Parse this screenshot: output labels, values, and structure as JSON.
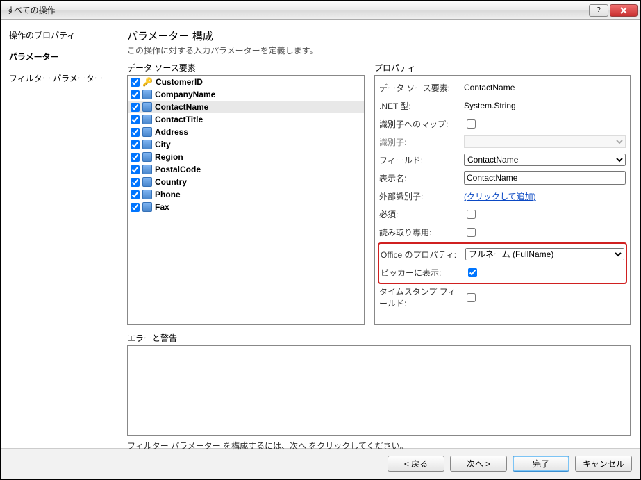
{
  "window": {
    "title": "すべての操作"
  },
  "nav": {
    "items": [
      {
        "label": "操作のプロパティ"
      },
      {
        "label": "パラメーター"
      },
      {
        "label": "フィルター パラメーター"
      }
    ],
    "activeIndex": 1
  },
  "main": {
    "heading": "パラメーター 構成",
    "subheading": "この操作に対する入力パラメーターを定義します。",
    "elementsLabel": "データ ソース要素",
    "propertiesLabel": "プロパティ",
    "errorsLabel": "エラーと警告",
    "hint": "フィルター パラメーター を構成するには、次へ をクリックしてください。"
  },
  "elements": [
    {
      "name": "CustomerID",
      "checked": true,
      "key": true
    },
    {
      "name": "CompanyName",
      "checked": true
    },
    {
      "name": "ContactName",
      "checked": true,
      "selected": true
    },
    {
      "name": "ContactTitle",
      "checked": true
    },
    {
      "name": "Address",
      "checked": true
    },
    {
      "name": "City",
      "checked": true
    },
    {
      "name": "Region",
      "checked": true
    },
    {
      "name": "PostalCode",
      "checked": true
    },
    {
      "name": "Country",
      "checked": true
    },
    {
      "name": "Phone",
      "checked": true
    },
    {
      "name": "Fax",
      "checked": true
    }
  ],
  "properties": {
    "dataSourceElement": {
      "label": "データ ソース要素:",
      "value": "ContactName"
    },
    "netType": {
      "label": ".NET 型:",
      "value": "System.String"
    },
    "mapToIdentifier": {
      "label": "識別子へのマップ:",
      "checked": false
    },
    "identifier": {
      "label": "識別子:",
      "value": ""
    },
    "field": {
      "label": "フィールド:",
      "value": "ContactName"
    },
    "displayName": {
      "label": "表示名:",
      "value": "ContactName"
    },
    "externalIdentifier": {
      "label": "外部識別子:",
      "linkText": "(クリックして追加)"
    },
    "required": {
      "label": "必須:",
      "checked": false
    },
    "readOnly": {
      "label": "読み取り専用:",
      "checked": false
    },
    "officeProperty": {
      "label": "Office のプロパティ:",
      "value": "フルネーム (FullName)"
    },
    "showInPicker": {
      "label": "ピッカーに表示:",
      "checked": true
    },
    "timestampField": {
      "label": "タイムスタンプ フィールド:",
      "checked": false
    }
  },
  "footer": {
    "back": "< 戻る",
    "next": "次へ >",
    "finish": "完了",
    "cancel": "キャンセル"
  }
}
